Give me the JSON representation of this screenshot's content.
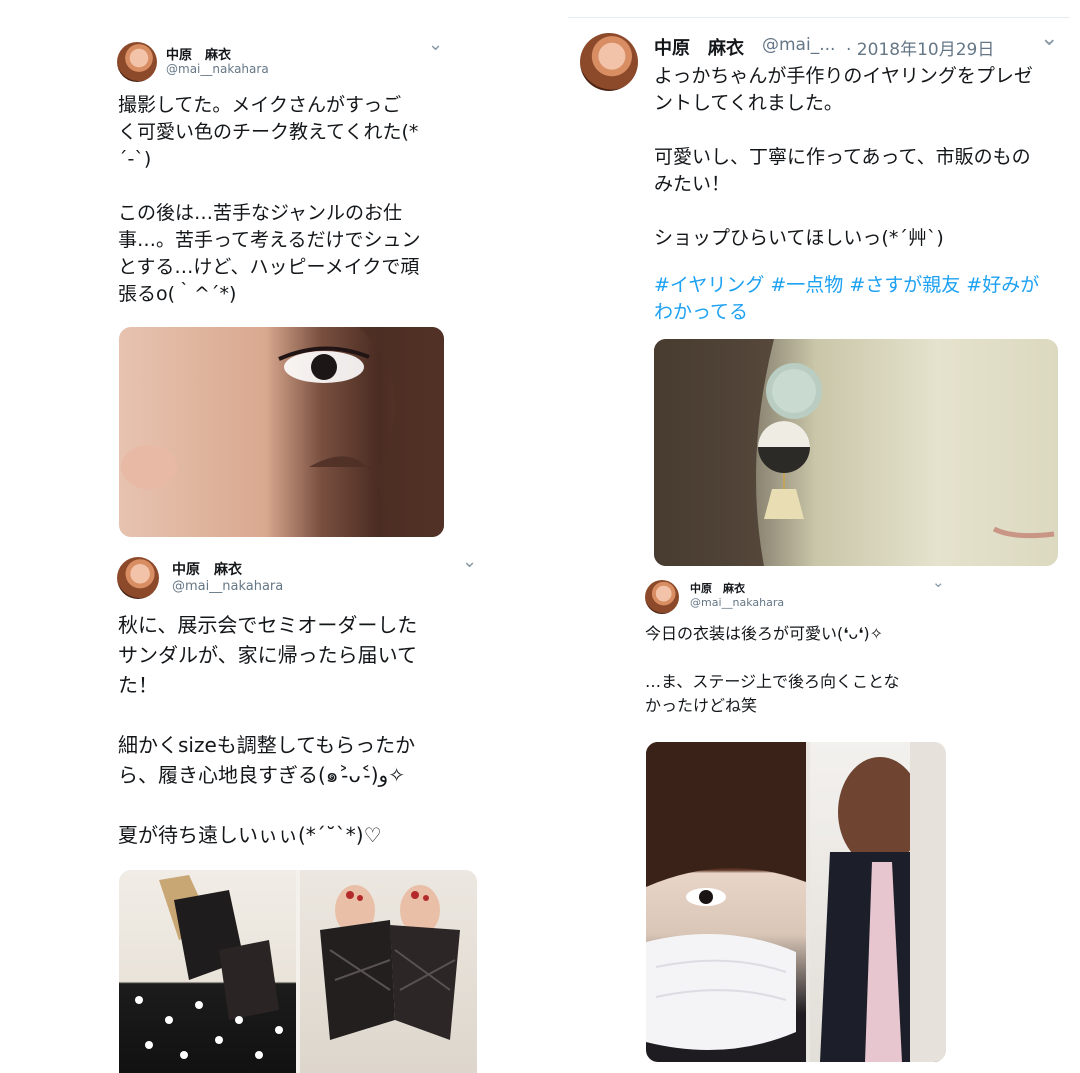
{
  "tweets": [
    {
      "name": "中原　麻衣",
      "handle": "@mai__nakahara",
      "text": "撮影してた。メイクさんがすっご\nく可愛い色のチーク教えてくれた(*\n´-`)\n\nこの後は…苦手なジャンルのお仕\n事…。苦手って考えるだけでシュン\nとする…けど、ハッピーメイクで頑\n張るo(｀^´*)",
      "chevron": "⌄"
    },
    {
      "name": "中原　麻衣",
      "handle": "@mai__nakahara",
      "text": "秋に、展示会でセミオーダーした\nサンダルが、家に帰ったら届いて\nた！\n\n細かくsizeも調整してもらったか\nら、履き心地良すぎる(๑˃̵ᴗ˂̵)و✧\n\n夏が待ち遠しいぃぃ(*´˘`*)♡",
      "chevron": "⌄"
    },
    {
      "name": "中原　麻衣",
      "handle": "@mai_...",
      "date": "· 2018年10月29日",
      "text": "よっかちゃんが手作りのイヤリングをプレゼ\nントしてくれました。\n\n可愛いし、丁寧に作ってあって、市販のもの\nみたい！\n\nショップひらいてほしいっ(*´艸`)",
      "hashtags": "#イヤリング #一点物 #さすが親友 #好みが\nわかってる",
      "chevron": "⌄"
    },
    {
      "name": "中原　麻衣",
      "handle": "@mai__nakahara",
      "text": "今日の衣装は後ろが可愛い(❛ᴗ❛)✧\n\n…ま、ステージ上で後ろ向くことな\nかったけどね笑",
      "chevron": "⌄"
    }
  ]
}
